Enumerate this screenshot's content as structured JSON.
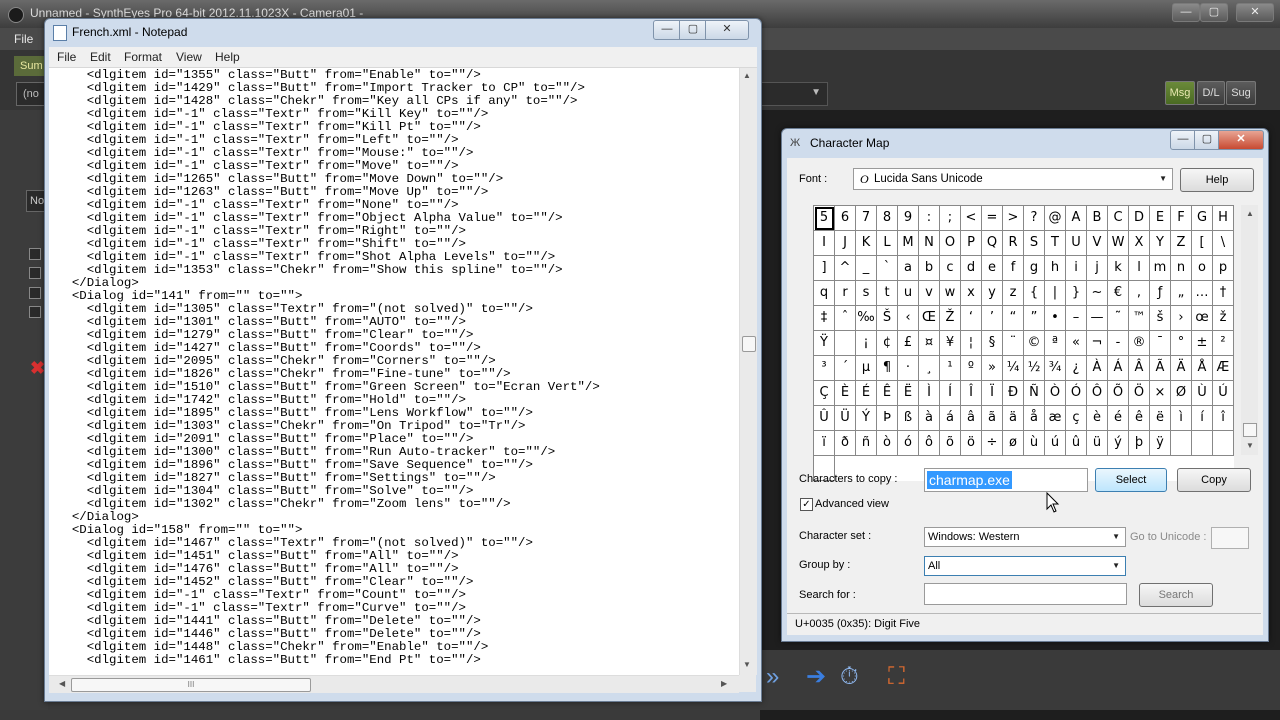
{
  "background_app": {
    "title": "Unnamed - SynthEyes Pro 64-bit 2012.11.1023X - Camera01 -",
    "window_controls": {
      "minimize": "—",
      "maximize": "▢",
      "close": "✕"
    },
    "menu_file": "File",
    "summary_tab": "Sum",
    "left_dropdown": "(no",
    "no_button": "No",
    "buttons": {
      "msg": "Msg",
      "dl": "D/L",
      "sug": "Sug"
    },
    "dropdown_arrow": "▼",
    "x_icon": "✖",
    "tool_icons": {
      "forward": "»",
      "arrow": "➔",
      "clock": "⏱",
      "frame": "⛶"
    },
    "colors": {
      "msg_active": "#5a7a2e",
      "summary_tab": "#5b6b3a",
      "delete_x": "#d83030"
    }
  },
  "notepad": {
    "title": "French.xml - Notepad",
    "window_controls": {
      "minimize": "—",
      "maximize": "▢",
      "close": "✕"
    },
    "menu": [
      "File",
      "Edit",
      "Format",
      "View",
      "Help"
    ],
    "content": "    <dlgitem id=\"1355\" class=\"Butt\" from=\"Enable\" to=\"\"/>\n    <dlgitem id=\"1429\" class=\"Butt\" from=\"Import Tracker to CP\" to=\"\"/>\n    <dlgitem id=\"1428\" class=\"Chekr\" from=\"Key all CPs if any\" to=\"\"/>\n    <dlgitem id=\"-1\" class=\"Textr\" from=\"Kill Key\" to=\"\"/>\n    <dlgitem id=\"-1\" class=\"Textr\" from=\"Kill Pt\" to=\"\"/>\n    <dlgitem id=\"-1\" class=\"Textr\" from=\"Left\" to=\"\"/>\n    <dlgitem id=\"-1\" class=\"Textr\" from=\"Mouse:\" to=\"\"/>\n    <dlgitem id=\"-1\" class=\"Textr\" from=\"Move\" to=\"\"/>\n    <dlgitem id=\"1265\" class=\"Butt\" from=\"Move Down\" to=\"\"/>\n    <dlgitem id=\"1263\" class=\"Butt\" from=\"Move Up\" to=\"\"/>\n    <dlgitem id=\"-1\" class=\"Textr\" from=\"None\" to=\"\"/>\n    <dlgitem id=\"-1\" class=\"Textr\" from=\"Object Alpha Value\" to=\"\"/>\n    <dlgitem id=\"-1\" class=\"Textr\" from=\"Right\" to=\"\"/>\n    <dlgitem id=\"-1\" class=\"Textr\" from=\"Shift\" to=\"\"/>\n    <dlgitem id=\"-1\" class=\"Textr\" from=\"Shot Alpha Levels\" to=\"\"/>\n    <dlgitem id=\"1353\" class=\"Chekr\" from=\"Show this spline\" to=\"\"/>\n  </Dialog>\n  <Dialog id=\"141\" from=\"\" to=\"\">\n    <dlgitem id=\"1305\" class=\"Textr\" from=\"(not solved)\" to=\"\"/>\n    <dlgitem id=\"1301\" class=\"Butt\" from=\"AUTO\" to=\"\"/>\n    <dlgitem id=\"1279\" class=\"Butt\" from=\"Clear\" to=\"\"/>\n    <dlgitem id=\"1427\" class=\"Butt\" from=\"Coords\" to=\"\"/>\n    <dlgitem id=\"2095\" class=\"Chekr\" from=\"Corners\" to=\"\"/>\n    <dlgitem id=\"1826\" class=\"Chekr\" from=\"Fine-tune\" to=\"\"/>\n    <dlgitem id=\"1510\" class=\"Butt\" from=\"Green Screen\" to=\"Ecran Vert\"/>\n    <dlgitem id=\"1742\" class=\"Butt\" from=\"Hold\" to=\"\"/>\n    <dlgitem id=\"1895\" class=\"Butt\" from=\"Lens Workflow\" to=\"\"/>\n    <dlgitem id=\"1303\" class=\"Chekr\" from=\"On Tripod\" to=\"Tr\"/>\n    <dlgitem id=\"2091\" class=\"Butt\" from=\"Place\" to=\"\"/>\n    <dlgitem id=\"1300\" class=\"Butt\" from=\"Run Auto-tracker\" to=\"\"/>\n    <dlgitem id=\"1896\" class=\"Butt\" from=\"Save Sequence\" to=\"\"/>\n    <dlgitem id=\"1827\" class=\"Butt\" from=\"Settings\" to=\"\"/>\n    <dlgitem id=\"1304\" class=\"Butt\" from=\"Solve\" to=\"\"/>\n    <dlgitem id=\"1302\" class=\"Chekr\" from=\"Zoom lens\" to=\"\"/>\n  </Dialog>\n  <Dialog id=\"158\" from=\"\" to=\"\">\n    <dlgitem id=\"1467\" class=\"Textr\" from=\"(not solved)\" to=\"\"/>\n    <dlgitem id=\"1451\" class=\"Butt\" from=\"All\" to=\"\"/>\n    <dlgitem id=\"1476\" class=\"Butt\" from=\"All\" to=\"\"/>\n    <dlgitem id=\"1452\" class=\"Butt\" from=\"Clear\" to=\"\"/>\n    <dlgitem id=\"-1\" class=\"Textr\" from=\"Count\" to=\"\"/>\n    <dlgitem id=\"-1\" class=\"Textr\" from=\"Curve\" to=\"\"/>\n    <dlgitem id=\"1441\" class=\"Butt\" from=\"Delete\" to=\"\"/>\n    <dlgitem id=\"1446\" class=\"Butt\" from=\"Delete\" to=\"\"/>\n    <dlgitem id=\"1448\" class=\"Chekr\" from=\"Enable\" to=\"\"/>\n    <dlgitem id=\"1461\" class=\"Butt\" from=\"End Pt\" to=\"\"/>",
    "scroll_arrows": {
      "up": "▲",
      "down": "▼",
      "left": "◀",
      "right": "▶"
    },
    "hthumb_grip": "III"
  },
  "charmap": {
    "title": "Character Map",
    "title_icon": "Ж",
    "window_controls": {
      "minimize": "—",
      "maximize": "▢",
      "close": "✕"
    },
    "font_label": "Font :",
    "font_icon": "O",
    "font_value": "Lucida Sans Unicode",
    "help_label": "Help",
    "characters": [
      "5",
      "6",
      "7",
      "8",
      "9",
      ":",
      ";",
      "<",
      "=",
      ">",
      "?",
      "@",
      "A",
      "B",
      "C",
      "D",
      "E",
      "F",
      "G",
      "H",
      "I",
      "J",
      "K",
      "L",
      "M",
      "N",
      "O",
      "P",
      "Q",
      "R",
      "S",
      "T",
      "U",
      "V",
      "W",
      "X",
      "Y",
      "Z",
      "[",
      "\\",
      "]",
      "^",
      "_",
      "`",
      "a",
      "b",
      "c",
      "d",
      "e",
      "f",
      "g",
      "h",
      "i",
      "j",
      "k",
      "l",
      "m",
      "n",
      "o",
      "p",
      "q",
      "r",
      "s",
      "t",
      "u",
      "v",
      "w",
      "x",
      "y",
      "z",
      "{",
      "|",
      "}",
      "~",
      "€",
      ",",
      "ƒ",
      "„",
      "…",
      "†",
      "‡",
      "ˆ",
      "‰",
      "Š",
      "‹",
      "Œ",
      "Ž",
      "‘",
      "’",
      "“",
      "”",
      "•",
      "–",
      "—",
      "˜",
      "™",
      "š",
      "›",
      "œ",
      "ž",
      "Ÿ",
      " ",
      "¡",
      "¢",
      "£",
      "¤",
      "¥",
      "¦",
      "§",
      "¨",
      "©",
      "ª",
      "«",
      "¬",
      "-",
      "®",
      "¯",
      "°",
      "±",
      "²",
      "³",
      "´",
      "µ",
      "¶",
      "·",
      "¸",
      "¹",
      "º",
      "»",
      "¼",
      "½",
      "¾",
      "¿",
      "À",
      "Á",
      "Â",
      "Ã",
      "Ä",
      "Å",
      "Æ",
      "Ç",
      "È",
      "É",
      "Ê",
      "Ë",
      "Ì",
      "Í",
      "Î",
      "Ï",
      "Ð",
      "Ñ",
      "Ò",
      "Ó",
      "Ô",
      "Õ",
      "Ö",
      "×",
      "Ø",
      "Ù",
      "Ú",
      "Û",
      "Ü",
      "Ý",
      "Þ",
      "ß",
      "à",
      "á",
      "â",
      "ã",
      "ä",
      "å",
      "æ",
      "ç",
      "è",
      "é",
      "ê",
      "ë",
      "ì",
      "í",
      "î",
      "ï",
      "ð",
      "ñ",
      "ò",
      "ó",
      "ô",
      "õ",
      "ö",
      "÷",
      "ø",
      "ù",
      "ú",
      "û",
      "ü",
      "ý",
      "þ",
      "ÿ",
      "",
      "",
      "",
      ""
    ],
    "selected_char": "5",
    "chars_to_copy_label": "Characters to copy :",
    "chars_to_copy_value": "charmap.exe",
    "select_label": "Select",
    "copy_label": "Copy",
    "advanced_view_label": "Advanced view",
    "advanced_view_checked": true,
    "check_mark": "✓",
    "charset_label": "Character set :",
    "charset_value": "Windows: Western",
    "goto_unicode_label": "Go to Unicode :",
    "groupby_label": "Group by :",
    "groupby_value": "All",
    "search_for_label": "Search for :",
    "search_label": "Search",
    "status": "U+0035 (0x35): Digit Five",
    "dropdown_arrow": "▼",
    "scroll_arrows": {
      "up": "▲",
      "down": "▼"
    }
  }
}
